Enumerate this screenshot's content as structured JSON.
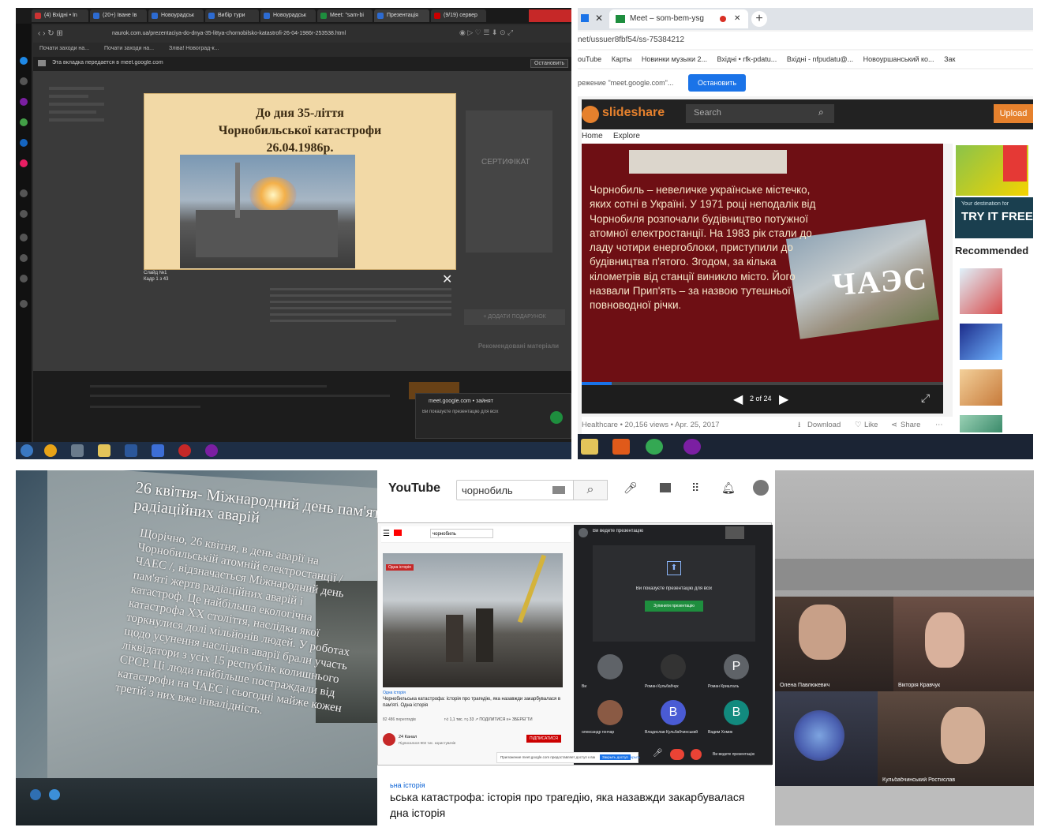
{
  "panel1": {
    "tabs": [
      {
        "label": "(4) Вхідні • In",
        "color": "#c33"
      },
      {
        "label": "(20+) Іване Ів",
        "color": "#2d6bd1"
      },
      {
        "label": "Новоурадськ",
        "color": "#2d6bd1"
      },
      {
        "label": "Вибір тури",
        "color": "#2d6bd1"
      },
      {
        "label": "Новоурадськ",
        "color": "#2d6bd1"
      },
      {
        "label": "Meet: \"sam-bi",
        "color": "#1e8e3e"
      },
      {
        "label": "Презентація",
        "color": "#2d6bd1"
      },
      {
        "label": "(9/19) сервер",
        "color": "#c00"
      }
    ],
    "url": "naurok.com.ua/prezentaciya-do-dnya-35-littya-chornobilsko-katastrofi-26-04-1986r-253538.html",
    "bookmarks": [
      "Почати заходи на...",
      "Почати заходи на...",
      "Зліва! Новоград-к..."
    ],
    "notice": "Эта вкладка передается в meet.google.com",
    "stop_label": "Остановить",
    "slide_title": [
      "До дня 35-ліття",
      "Чорнобильської катастрофи",
      "26.04.1986р."
    ],
    "slide_caption": [
      "Слайд №1",
      "Кадр 1 з 43"
    ],
    "meet_popup": {
      "title": "meet.google.com • зайнят",
      "text": "Ви показуєте презентацію для всіх"
    },
    "cert_label": "СЕРТИФІКАТ",
    "side_button": "+ ДОДАТИ ПОДАРУНОК",
    "side_heading": "Рекомендовані матеріали"
  },
  "panel2": {
    "tab1": "Meet – som-bem-ysg",
    "url": "net/ussuer8fbf54/ss-75384212",
    "bookmarks": [
      "ouTube",
      "Карты",
      "Новинки музыки 2...",
      "Вхідні • rfk-pdatu...",
      "Вхідні - nfpudatu@...",
      "Новоуршанський ко...",
      "Зак"
    ],
    "share_text": "режение \"meet.google.com\"...",
    "stop_label": "Остановить",
    "brand": "slideshare",
    "search_placeholder": "Search",
    "upload_label": "Upload",
    "nav": [
      "Home",
      "Explore"
    ],
    "slide_text": "Чорнобиль – невеличке українське містечко, яких сотні в Україні. У 1971 році неподалік від Чорнобиля розпочали будівництво потужної атомної електростанції. На 1983 рік стали до ладу чотири енергоблоки, приступили до будівництва п'ятого. Згодом, за кілька кілометрів від станції виникло місто. Його назвали Прип'ять – за назвою тутешньої повноводної річки.",
    "sign_text": "ЧАЭС",
    "page_counter": "2 of 24",
    "meta": "Healthcare • 20,156 views • Apr. 25, 2017",
    "download_label": "Download",
    "like_label": "Like",
    "share_label": "Share",
    "ad_small": "Your destination for",
    "ad_big": "TRY IT FREE",
    "recommended": "Recommended"
  },
  "panel3": {
    "title": "26 квітня- Міжнародний день пам'яті радіаційних аварій",
    "body": "Щорічно, 26 квітня, в день аварії на Чорнобильській атомній електростанції / ЧАЕС /, відзначається Міжнародний день пам'яті жертв радіаційних аварій і катастроф. Це найбільша екологічна катастрофа XX століття, наслідки якої торкнулися долі мільйонів людей. У роботах щодо усунення наслідків аварії брали участь ліквідатори з усіх 15 республік колишнього СРСР. Ці люди найбільше постраждали від катастрофи на ЧАЕС і сьогодні майже кожен третій з них вже інвалідність."
  },
  "panel4": {
    "yt_logo": "YouTube",
    "search_value": "чорнобиль",
    "video_title": "Чорнобильська катастрофа: історія про трагедію, яка назавжди закарбувалася в пам'яті. Одна історія",
    "video_tag": "Одна історія",
    "video_views": "82 486 переглядів",
    "video_likes": "1,1 тис.",
    "video_dislikes": "33",
    "video_share": "ПОДІЛИТИСЯ",
    "video_save": "ЗБЕРЕГТИ",
    "channel_name": "24 Канал",
    "channel_subs": "Підписалися 902 тис. користувачів",
    "subscribe_label": "ПІДПИСАТИСЯ",
    "meet_header": "Ви ведете презентацію",
    "meet_present_text": "Ви показуєте презентацію для всіх",
    "meet_stop_label": "Зупинити презентацію",
    "participants": [
      {
        "name": "Ви",
        "letter": "",
        "color": "#5f6368"
      },
      {
        "name": "Роман Кульбабчук",
        "letter": "",
        "color": "#333"
      },
      {
        "name": "Роман Кришталь",
        "letter": "P",
        "color": "#5f6368"
      },
      {
        "name": "олександр гончар",
        "letter": "",
        "color": "#8a5a44"
      },
      {
        "name": "Владислав Кульбабчинський",
        "letter": "B",
        "color": "#4a5bd4"
      },
      {
        "name": "Вадим Хомик",
        "letter": "B",
        "color": "#128a7e"
      }
    ],
    "meet_footer": "Ви ведете презентацію",
    "share_notice": "Приложение meet.google.com предоставляет доступ к вашему экрану",
    "share_stop": "Закрыть доступ",
    "share_hide": "Скрыть",
    "channel_tag": "Одна історія",
    "caption_line": "ьська катастрофа: історія про трагедію, яка назавжди закарбувалася",
    "caption_line2": "дна історія",
    "caption_prefix": "ьна історія"
  },
  "panel5": {
    "tiles": [
      {
        "name": "Олена Павлюкевич"
      },
      {
        "name": "Вікторія Кравчук"
      },
      {
        "name": "Кульбабчинський Ростислав"
      }
    ]
  },
  "colors": {
    "slideshare_orange": "#e6812d",
    "slide_red": "#6e0f14",
    "meet_dark": "#202124",
    "meet_green": "#1e8e3e",
    "stop_blue": "#1a73e8",
    "youtube_red": "#ff0000"
  }
}
